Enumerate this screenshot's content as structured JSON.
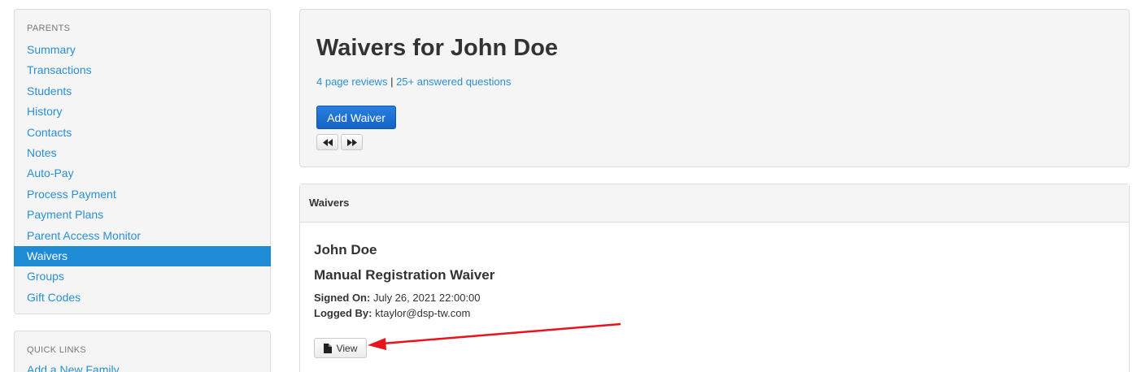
{
  "sidebar": {
    "heading": "PARENTS",
    "items": [
      {
        "label": "Summary"
      },
      {
        "label": "Transactions"
      },
      {
        "label": "Students"
      },
      {
        "label": "History"
      },
      {
        "label": "Contacts"
      },
      {
        "label": "Notes"
      },
      {
        "label": "Auto-Pay"
      },
      {
        "label": "Process Payment"
      },
      {
        "label": "Payment Plans"
      },
      {
        "label": "Parent Access Monitor"
      },
      {
        "label": "Waivers",
        "active": true
      },
      {
        "label": "Groups"
      },
      {
        "label": "Gift Codes"
      }
    ]
  },
  "quick_links": {
    "heading": "QUICK LINKS",
    "items": [
      {
        "label": "Add a New Family"
      }
    ]
  },
  "header": {
    "title": "Waivers for John Doe",
    "reviews_link": "4 page reviews",
    "separator": " | ",
    "questions_link": "25+ answered questions",
    "add_button": "Add Waiver",
    "pager": {
      "prev_icon": "double-left-arrow",
      "next_icon": "double-right-arrow"
    }
  },
  "waivers": {
    "heading": "Waivers",
    "student_name": "John Doe",
    "waiver_name": "Manual Registration Waiver",
    "signed_label": "Signed On:",
    "signed_value": " July 26, 2021 22:00:00",
    "logged_label": "Logged By:",
    "logged_value": " ktaylor@dsp-tw.com",
    "view_button": "View",
    "view_icon": "document-icon"
  },
  "colors": {
    "link": "#2a8fd1",
    "active_bg": "#1e8bd4",
    "primary_button": "#1263c4",
    "annotation_arrow": "#e8141a"
  }
}
